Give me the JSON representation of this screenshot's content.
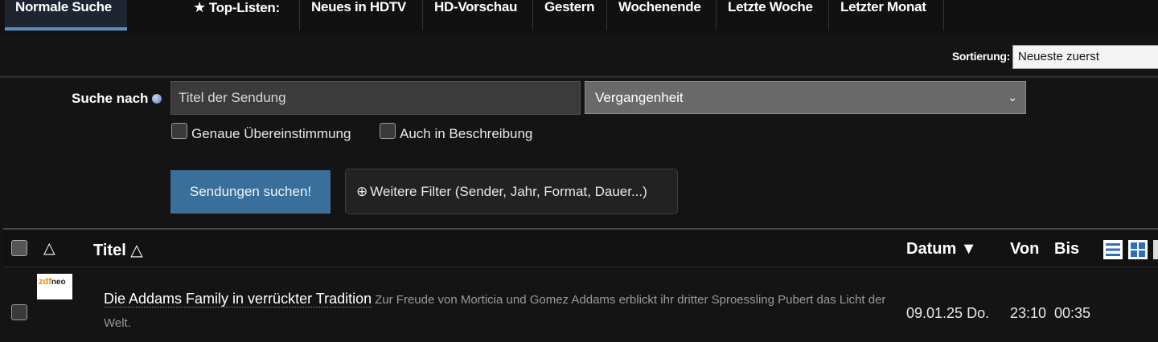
{
  "nav": {
    "active_tab": "Normale Suche",
    "top_lists_label": "Top-Listen:",
    "links": [
      "Neues in HDTV",
      "HD-Vorschau",
      "Gestern",
      "Wochenende",
      "Letzte Woche",
      "Letzter Monat"
    ]
  },
  "sort": {
    "label": "Sortierung:",
    "value": "Neueste zuerst"
  },
  "search": {
    "label": "Suche nach",
    "input_placeholder": "Titel der Sendung",
    "time_value": "Vergangenheit",
    "exact_match_label": "Genaue Übereinstimmung",
    "in_description_label": "Auch in Beschreibung",
    "submit_label": "Sendungen suchen!",
    "more_filters_label": "Weitere Filter (Sender, Jahr, Format, Dauer...)"
  },
  "table": {
    "col_title": "Titel △",
    "col_date": "Datum ▼",
    "col_from": "Von",
    "col_to": "Bis",
    "rows": [
      {
        "channel_logo_top": "zdf",
        "channel_logo_bottom": "neo",
        "title": "Die Addams Family in verrückter Tradition",
        "description": "Zur Freude von Morticia und Gomez Addams erblickt ihr dritter Sproessling Pubert das Licht der Welt.",
        "date": "09.01.25 Do.",
        "from": "23:10",
        "to": "00:35"
      }
    ]
  },
  "colors": {
    "accent": "#5a8fc2",
    "search_button": "#3a6f9c",
    "background": "#141414"
  }
}
